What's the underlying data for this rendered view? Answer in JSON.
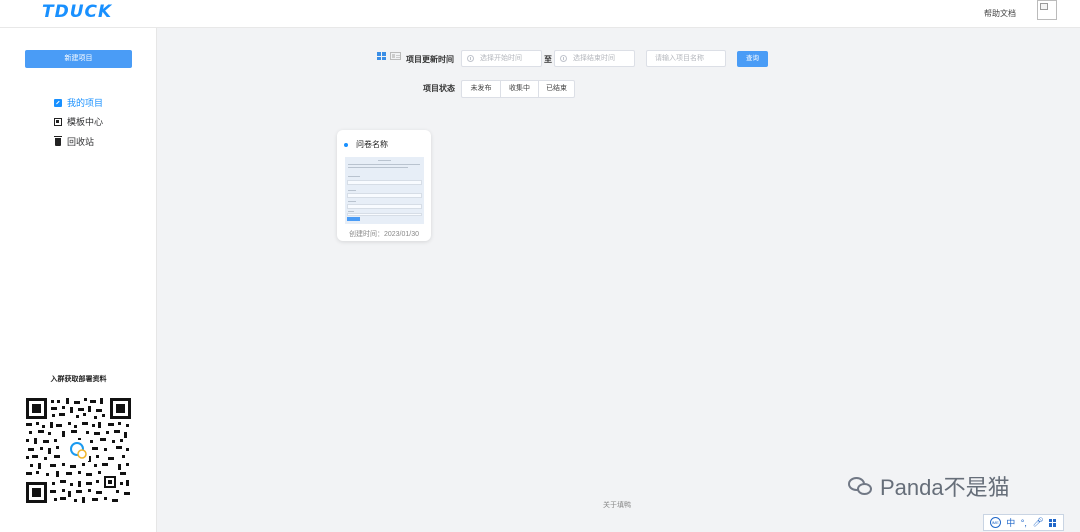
{
  "app": {
    "logo": "TDUCK"
  },
  "header": {
    "help_link": "帮助文档"
  },
  "sidebar": {
    "new_project_label": "新建项目",
    "items": [
      {
        "label": "我的项目",
        "icon": "edit-icon",
        "active": true
      },
      {
        "label": "模板中心",
        "icon": "template-icon",
        "active": false
      },
      {
        "label": "回收站",
        "icon": "trash-icon",
        "active": false
      }
    ],
    "qr_caption": "入群获取部署资料"
  },
  "filters": {
    "update_time_label": "项目更新时间",
    "start_placeholder": "选择开始时间",
    "separator": "至",
    "end_placeholder": "选择结束时间",
    "name_placeholder": "请输入项目名称",
    "query_label": "查询",
    "status_label": "项目状态",
    "statuses": [
      "未发布",
      "收集中",
      "已结束"
    ]
  },
  "projects": [
    {
      "title": "问卷名称",
      "created": "创建时间：2023/01/30"
    }
  ],
  "footer": {
    "link": "关于填鸭"
  },
  "watermark": {
    "text": "Panda不是猫"
  },
  "ime": {
    "lang": "中"
  },
  "colors": {
    "accent": "#1890ff",
    "button": "#4a9cf6",
    "background": "#f2f3f5"
  }
}
